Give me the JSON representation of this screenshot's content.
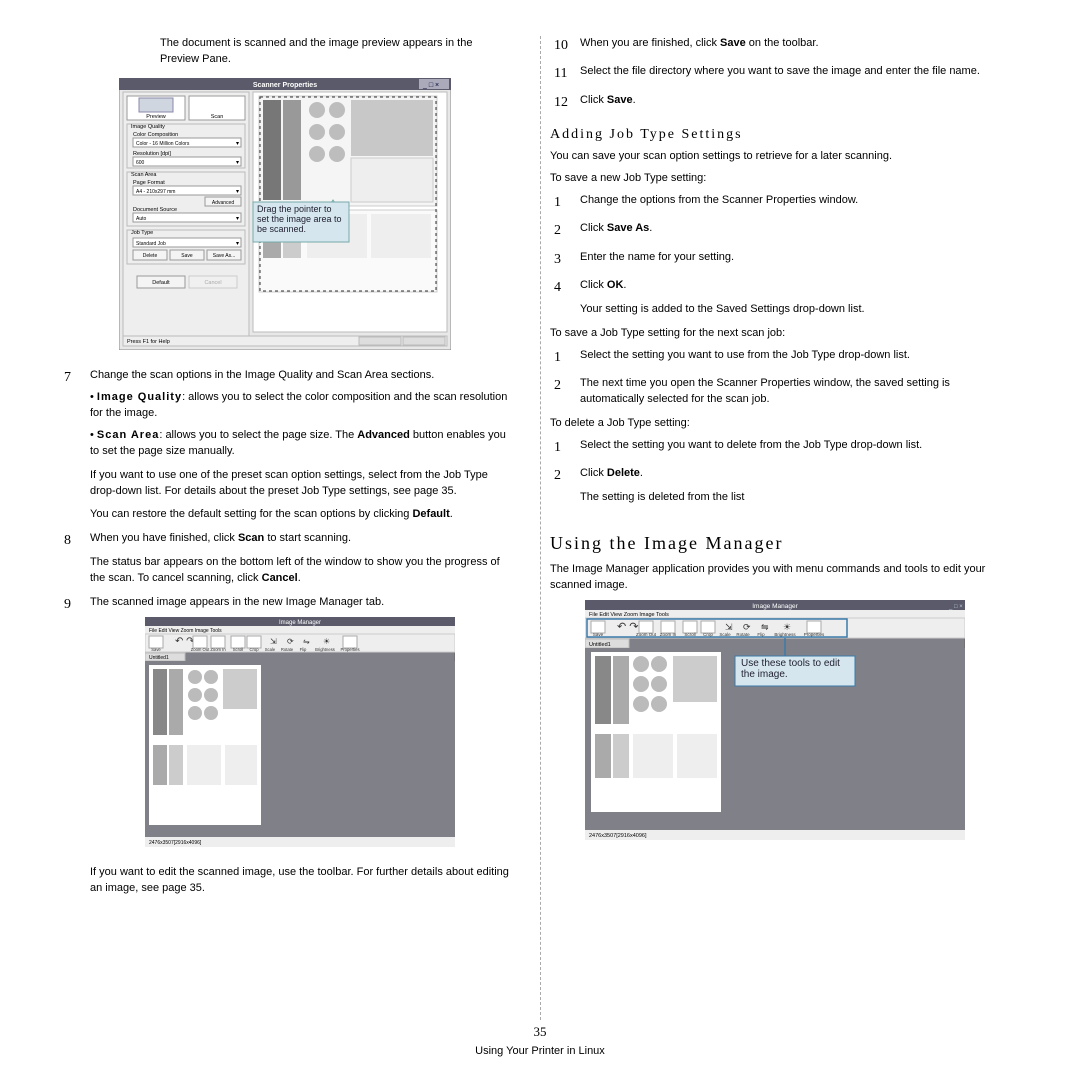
{
  "left": {
    "intro": "The document is scanned and the image preview appears in the Preview Pane.",
    "scanprops": {
      "title": "Scanner Properties",
      "preview": "Preview",
      "scan": "Scan",
      "imgq": "Image Quality",
      "colorcomp": "Color Composition",
      "colorsel": "Color - 16 Million Colors",
      "res": "Resolution [dpi]",
      "resval": "600",
      "scanarea": "Scan Area",
      "pagefmt": "Page Format",
      "pagesel": "A4 - 210x297 mm",
      "adv": "Advanced",
      "docsrc": "Document Source",
      "auto": "Auto",
      "jobtype": "Job Type",
      "std": "Standard Job",
      "delete": "Delete",
      "save": "Save",
      "saveas": "Save As...",
      "default": "Default",
      "cancel": "Cancel",
      "help": "Press F1 for Help",
      "tip": "Drag the pointer to set the image area to be scanned."
    },
    "s7": {
      "lead": "Change the scan options in the Image Quality and Scan Area sections.",
      "b1_t": "Image Quality",
      "b1": ": allows you to select the color composition and the scan resolution for the image.",
      "b2_t": "Scan Area",
      "b2": ": allows you to select the page size. The ",
      "b2b": "Advanced",
      "b2c": " button enables you to set the page size manually.",
      "p1": "If you want to use one of the preset scan option settings, select from the Job Type drop-down list. For details about the preset Job Type settings, see page 35.",
      "p2a": "You can restore the default setting for the scan options by clicking ",
      "p2b": "Default",
      "p2c": "."
    },
    "s8": {
      "a": "When you have finished, click ",
      "b": "Scan",
      "c": " to start scanning.",
      "p": "The status bar appears on the bottom left of the window to show you the progress of the scan. To cancel scanning, click ",
      "pb": "Cancel",
      "pc": "."
    },
    "s9": {
      "a": "The scanned image appears in the new Image Manager tab."
    },
    "imtitle": "Image Manager",
    "imlabels": [
      "Save",
      "Zoom Out",
      "Zoom In",
      "Scroll",
      "Crop",
      "Scale",
      "Rotate",
      "Flip",
      "Brightness",
      "Properties"
    ],
    "imstatus": "2476x3507[2916x4096]",
    "tail": "If you want to edit the scanned image, use the toolbar. For further details about editing an image, see page 35."
  },
  "right": {
    "s10": {
      "a": "When you are finished, click ",
      "b": "Save",
      "c": " on the toolbar."
    },
    "s11": "Select the file directory where you want to save the image and enter the file name.",
    "s12": {
      "a": "Click ",
      "b": "Save",
      "c": "."
    },
    "addh": "Adding Job Type Settings",
    "addp": "You can save your scan option settings to retrieve for a later scanning.",
    "saveh": "To save a new Job Type setting:",
    "sv1": "Change the options from the Scanner Properties window.",
    "sv2a": "Click ",
    "sv2b": "Save As",
    "sv2c": ".",
    "sv3": "Enter the name for your setting.",
    "sv4a": "Click ",
    "sv4b": "OK",
    "sv4c": ".",
    "sv4p": "Your setting is added to the Saved Settings drop-down list.",
    "nexth": "To save a Job Type setting for the next scan job:",
    "nx1": "Select the setting you want to use from the Job Type drop-down list.",
    "nx2": "The next time you open the Scanner Properties window, the saved setting is automatically selected for the scan job.",
    "delh": "To delete a Job Type setting:",
    "dl1": "Select the setting you want to delete from the Job Type drop-down list.",
    "dl2a": "Click ",
    "dl2b": "Delete",
    "dl2c": ".",
    "dl2p": "The setting is deleted from the list",
    "useh": "Using the Image Manager",
    "usep": "The Image Manager application provides you with menu commands and tools to edit your scanned image.",
    "tip": "Use these tools to edit the image."
  },
  "footer": {
    "num": "35",
    "txt": "Using Your Printer in Linux"
  }
}
